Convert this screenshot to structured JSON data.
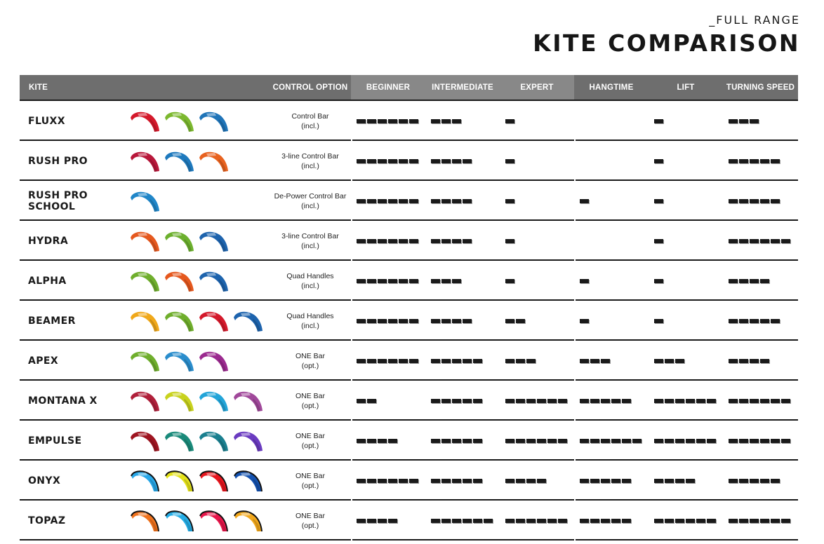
{
  "header": {
    "subtitle": "_FULL RANGE",
    "title": "KITE COMPARISON"
  },
  "columns": {
    "kite": "KITE",
    "control": "CONTROL OPTION",
    "beginner": "BEGINNER",
    "intermediate": "INTERMEDIATE",
    "expert": "EXPERT",
    "hangtime": "HANGTIME",
    "lift": "LIFT",
    "turning_speed": "TURNING SPEED"
  },
  "rating_scale_max": 6,
  "kites": [
    {
      "name": "FLUXX",
      "control_line1": "Control Bar",
      "control_line2": "(incl.)",
      "colors": [
        "#d4192b",
        "#7cb82f",
        "#1f74b8"
      ],
      "style": "foil",
      "ratings": {
        "beginner": 6,
        "intermediate": 3,
        "expert": 1,
        "hangtime": 0,
        "lift": 1,
        "turning_speed": 3
      }
    },
    {
      "name": "RUSH PRO",
      "control_line1": "3-line Control Bar",
      "control_line2": "(incl.)",
      "colors": [
        "#b8173a",
        "#1e79bd",
        "#e8621f"
      ],
      "style": "foil",
      "ratings": {
        "beginner": 6,
        "intermediate": 4,
        "expert": 1,
        "hangtime": 0,
        "lift": 1,
        "turning_speed": 5
      }
    },
    {
      "name": "RUSH PRO SCHOOL",
      "control_line1": "De-Power Control Bar",
      "control_line2": "(incl.)",
      "colors": [
        "#2086c8"
      ],
      "style": "foil",
      "ratings": {
        "beginner": 6,
        "intermediate": 4,
        "expert": 1,
        "hangtime": 1,
        "lift": 1,
        "turning_speed": 5
      }
    },
    {
      "name": "HYDRA",
      "control_line1": "3-line Control Bar",
      "control_line2": "(incl.)",
      "colors": [
        "#e5581e",
        "#6cb02e",
        "#1d63ad"
      ],
      "style": "foil",
      "ratings": {
        "beginner": 6,
        "intermediate": 4,
        "expert": 1,
        "hangtime": 0,
        "lift": 1,
        "turning_speed": 6
      }
    },
    {
      "name": "ALPHA",
      "control_line1": "Quad Handles",
      "control_line2": "(incl.)",
      "colors": [
        "#6fae2c",
        "#e5581e",
        "#1d63ad"
      ],
      "style": "foil",
      "ratings": {
        "beginner": 6,
        "intermediate": 3,
        "expert": 1,
        "hangtime": 1,
        "lift": 1,
        "turning_speed": 4
      }
    },
    {
      "name": "BEAMER",
      "control_line1": "Quad Handles",
      "control_line2": "(incl.)",
      "colors": [
        "#f0a81a",
        "#6fae2c",
        "#d4192b",
        "#1d63ad"
      ],
      "style": "foil",
      "ratings": {
        "beginner": 6,
        "intermediate": 4,
        "expert": 2,
        "hangtime": 1,
        "lift": 1,
        "turning_speed": 5
      }
    },
    {
      "name": "APEX",
      "control_line1": "ONE Bar",
      "control_line2": "(opt.)",
      "colors": [
        "#6fae2c",
        "#2a8dcc",
        "#9b2a8f"
      ],
      "style": "foil",
      "ratings": {
        "beginner": 6,
        "intermediate": 5,
        "expert": 3,
        "hangtime": 3,
        "lift": 3,
        "turning_speed": 4
      }
    },
    {
      "name": "MONTANA X",
      "control_line1": "ONE Bar",
      "control_line2": "(opt.)",
      "colors": [
        "#b01f3a",
        "#c8d21e",
        "#22a4d8",
        "#a0489a"
      ],
      "style": "foil",
      "ratings": {
        "beginner": 2,
        "intermediate": 5,
        "expert": 6,
        "hangtime": 5,
        "lift": 6,
        "turning_speed": 6
      }
    },
    {
      "name": "EMPULSE",
      "control_line1": "ONE Bar",
      "control_line2": "(opt.)",
      "colors": [
        "#9e1420",
        "#1a8a7a",
        "#1a7f8f",
        "#6a3bc0"
      ],
      "style": "foil",
      "ratings": {
        "beginner": 4,
        "intermediate": 5,
        "expert": 6,
        "hangtime": 6,
        "lift": 6,
        "turning_speed": 6
      }
    },
    {
      "name": "ONYX",
      "control_line1": "ONE Bar",
      "control_line2": "(opt.)",
      "colors": [
        "#29a8e8",
        "#e4e21a",
        "#e8161e",
        "#1452b0"
      ],
      "style": "lei",
      "ratings": {
        "beginner": 6,
        "intermediate": 5,
        "expert": 4,
        "hangtime": 5,
        "lift": 4,
        "turning_speed": 5
      }
    },
    {
      "name": "TOPAZ",
      "control_line1": "ONE Bar",
      "control_line2": "(opt.)",
      "colors": [
        "#f0731e",
        "#25ade6",
        "#e8164a",
        "#f2a81c"
      ],
      "style": "lei",
      "ratings": {
        "beginner": 4,
        "intermediate": 6,
        "expert": 6,
        "hangtime": 5,
        "lift": 6,
        "turning_speed": 6
      }
    }
  ]
}
